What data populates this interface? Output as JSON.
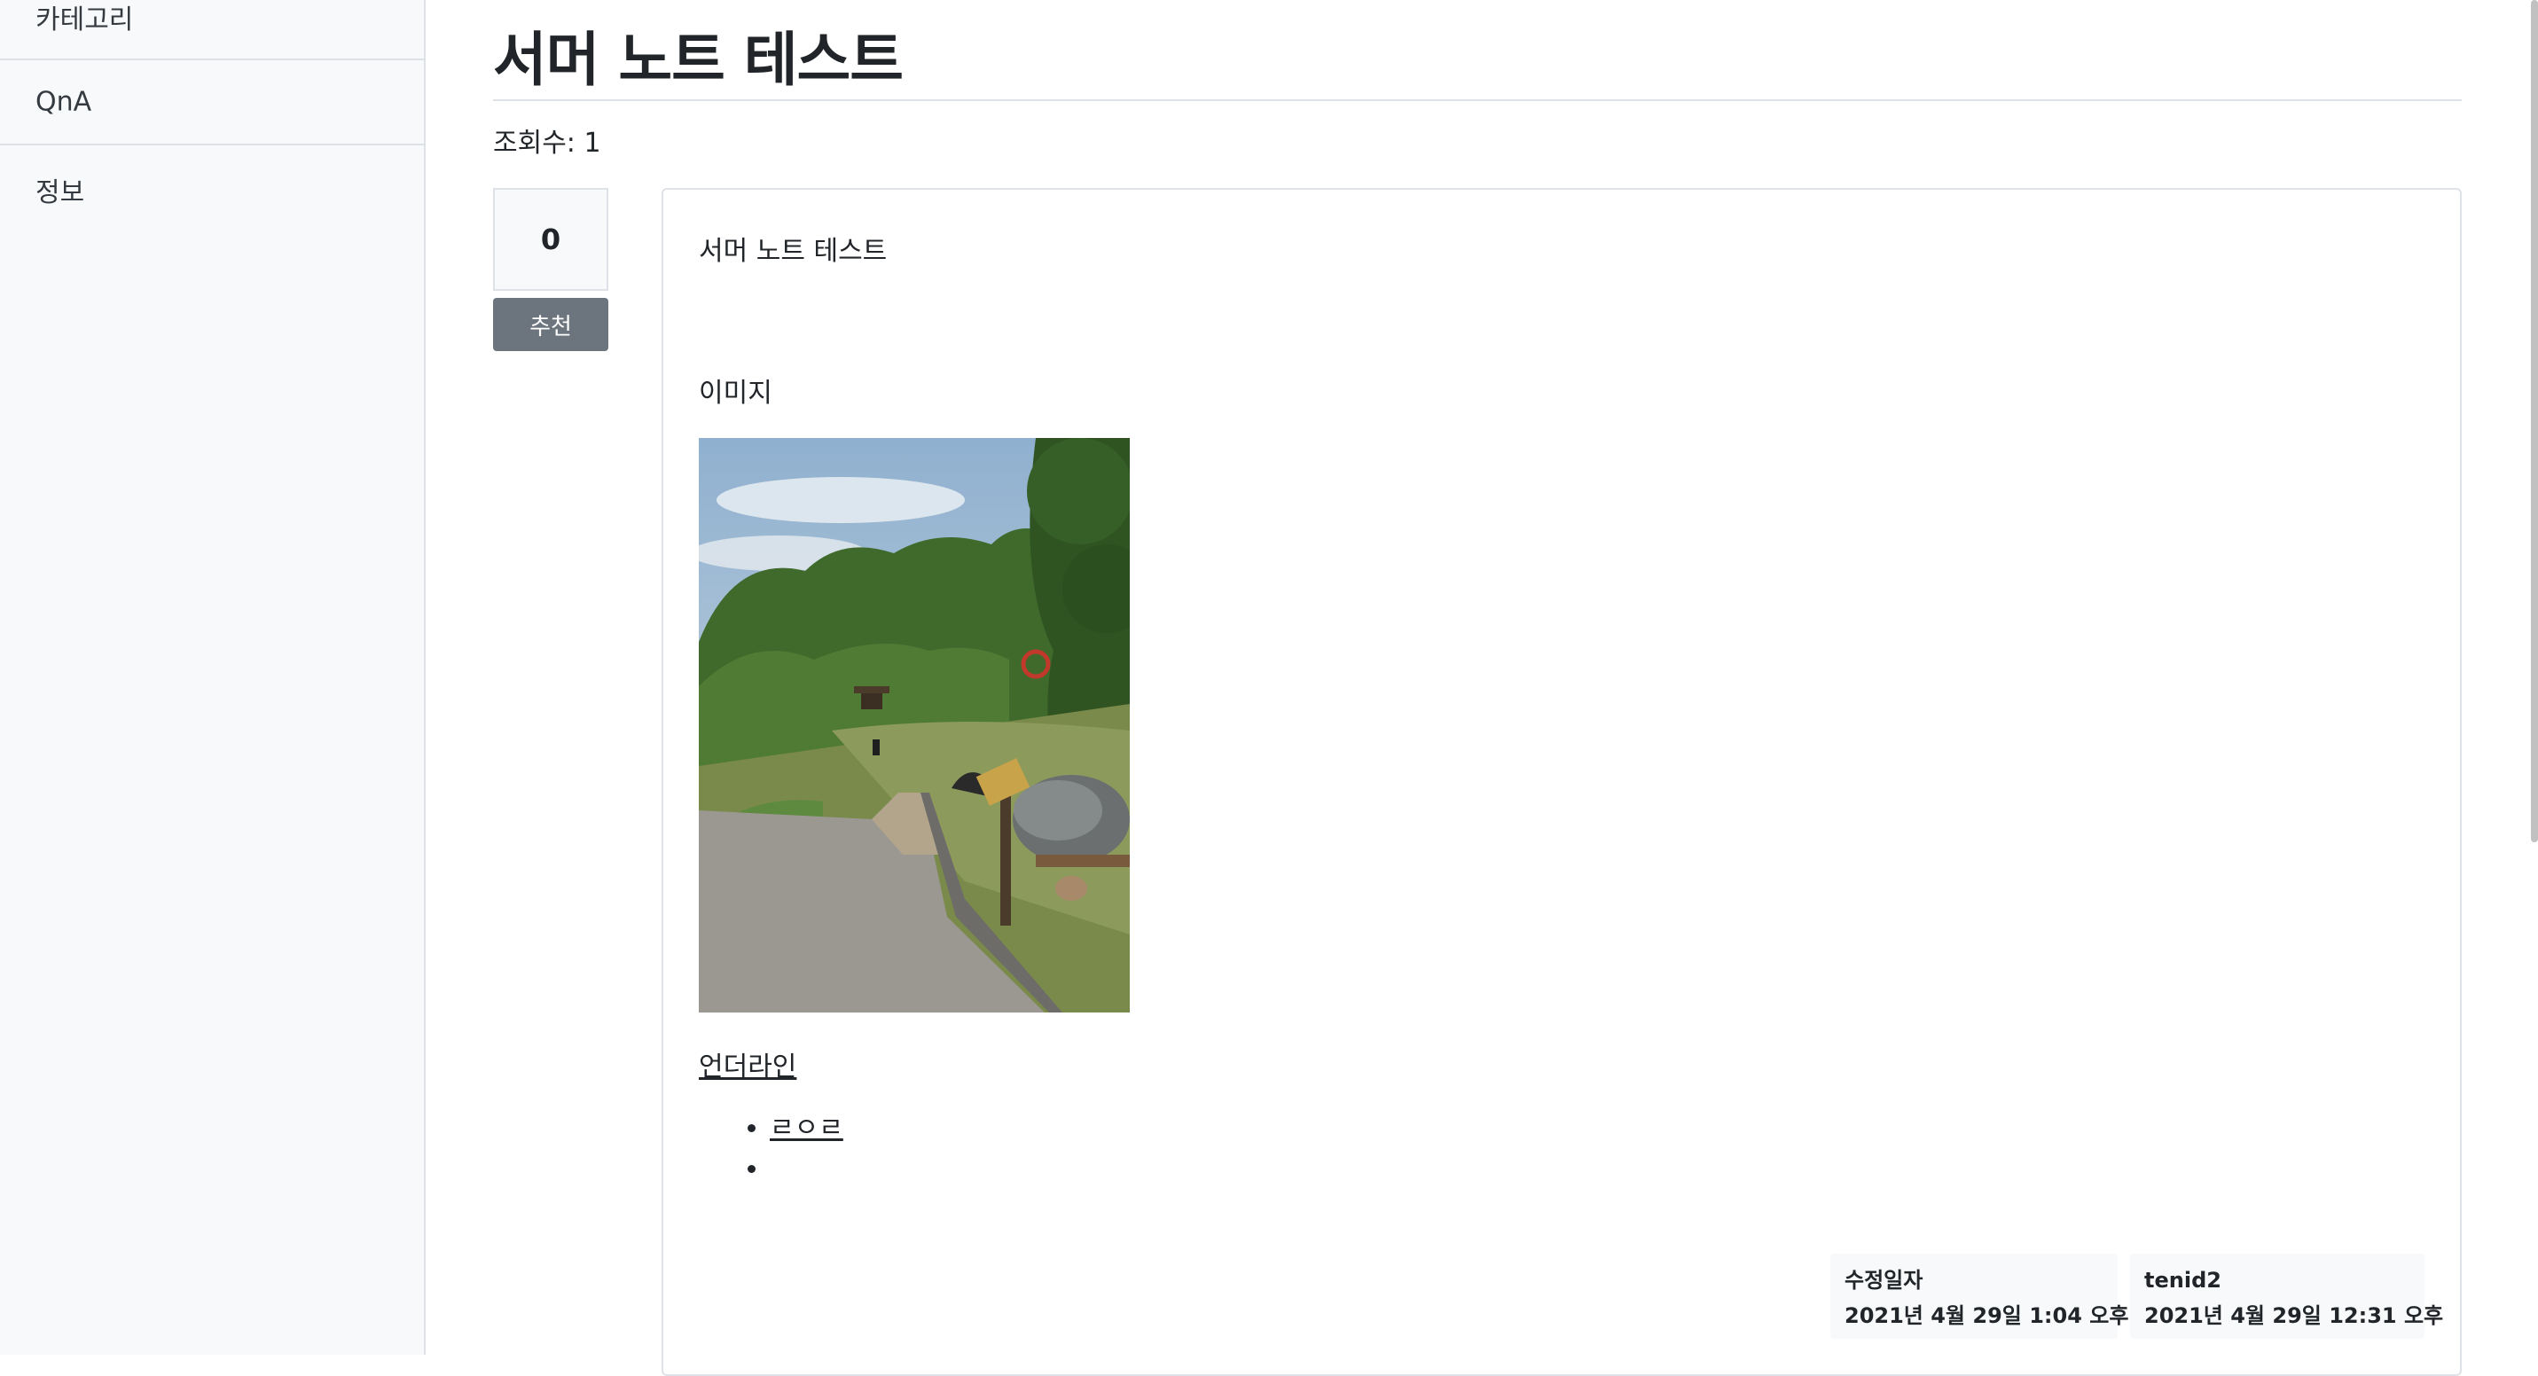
{
  "sidebar": {
    "items": [
      {
        "label": "카테고리"
      },
      {
        "label": "QnA"
      },
      {
        "label": "정보"
      }
    ]
  },
  "post": {
    "title": "서머 노트 테스트",
    "view_count": "조회수: 1",
    "votes": "0",
    "recommend_label": "추천",
    "content": {
      "heading": "서머 노트 테스트",
      "image_label": "이미지",
      "image_icon": "park-path-photo",
      "underline_text": "언더라인",
      "list_items": [
        "ㄹㅇㄹ",
        ""
      ]
    },
    "meta": {
      "edited_label": "수정일자",
      "edited_date": "2021년 4월 29일 1:04 오후",
      "author": "tenid2",
      "created_date": "2021년 4월 29일 12:31 오후"
    }
  },
  "colors": {
    "sidebar_bg": "#f8f9fa",
    "border": "#dee2e6",
    "button_bg": "#6c757d",
    "text": "#212529"
  }
}
